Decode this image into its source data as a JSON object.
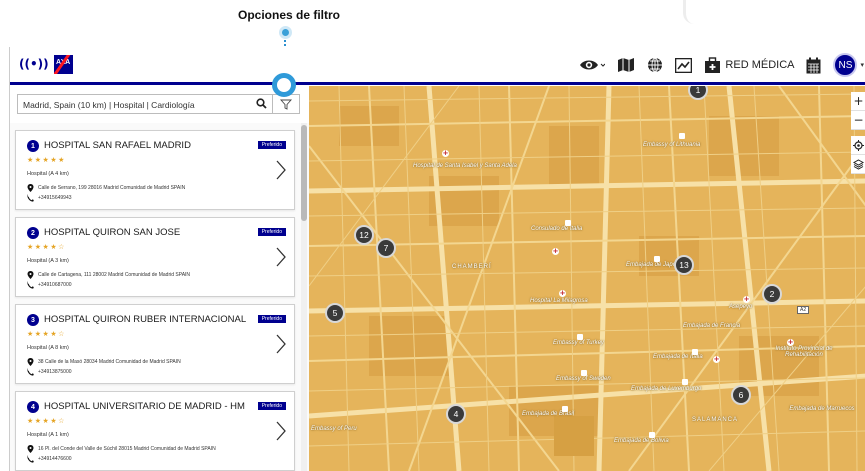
{
  "callout": {
    "label": "Opciones de filtro"
  },
  "header": {
    "brand": "AXA",
    "red_medica": "RED MÉDICA",
    "user_initials": "NS"
  },
  "search": {
    "value": "Madrid, Spain (10 km) | Hospital | Cardiología"
  },
  "results": [
    {
      "number": "1",
      "name": "HOSPITAL SAN RAFAEL MADRID",
      "badge": "Preferido",
      "rating": 5,
      "stars": "★★★★★",
      "distance": "Hospital (A 4 km)",
      "address": "Calle de Serrano, 199 28016 Madrid Comunidad de Madrid SPAIN",
      "phone": "+34915649943"
    },
    {
      "number": "2",
      "name": "HOSPITAL QUIRON SAN JOSE",
      "badge": "Preferido",
      "rating": 4,
      "stars": "★★★★☆",
      "distance": "Hospital (A 3 km)",
      "address": "Calle de Cartagena, 111 28002 Madrid Comunidad de Madrid SPAIN",
      "phone": "+34910687000"
    },
    {
      "number": "3",
      "name": "HOSPITAL QUIRON RUBER INTERNACIONAL",
      "badge": "Preferido",
      "rating": 4,
      "stars": "★★★★☆",
      "distance": "Hospital (A 8 km)",
      "address": "38 Calle de la Masó 28034 Madrid Comunidad de Madrid SPAIN",
      "phone": "+34913875000"
    },
    {
      "number": "4",
      "name": "HOSPITAL UNIVERSITARIO DE MADRID - HM",
      "badge": "Preferido",
      "rating": 4,
      "stars": "★★★★☆",
      "distance": "Hospital (A 1 km)",
      "address": "16 Pl. del Conde del Valle de Súchil 28015 Madrid Comunidad de Madrid SPAIN",
      "phone": "+34914476600"
    }
  ],
  "map": {
    "zoom_in": "+",
    "zoom_out": "−",
    "road_shield": "A2",
    "clusters": [
      "1",
      "12",
      "7",
      "5",
      "13",
      "2",
      "4",
      "6"
    ],
    "labels": [
      "Hospital de Santa Isabel y Santa Adela",
      "Embassy of Lithuania",
      "Consulado de Italia",
      "CHAMBERÍ",
      "Embajada de Japón",
      "Hospital La Milagrosa",
      "Asepeyo",
      "Embajada de Francia",
      "Embassy of Turkey",
      "Embajada de Italia",
      "Instituto Provincial de Rehabilitación",
      "Embassy of Sweden",
      "Embajada de Luxemburgo",
      "Embajada de Brasil",
      "SALAMANCA",
      "Embajada de Bolivia",
      "Embajada de Marruecos",
      "Embassy of Peru"
    ]
  },
  "colors": {
    "axa_blue": "#00008f",
    "axa_red": "#ff1721",
    "map_base": "#e7b55c",
    "callout_blue": "#2f9ad9"
  }
}
